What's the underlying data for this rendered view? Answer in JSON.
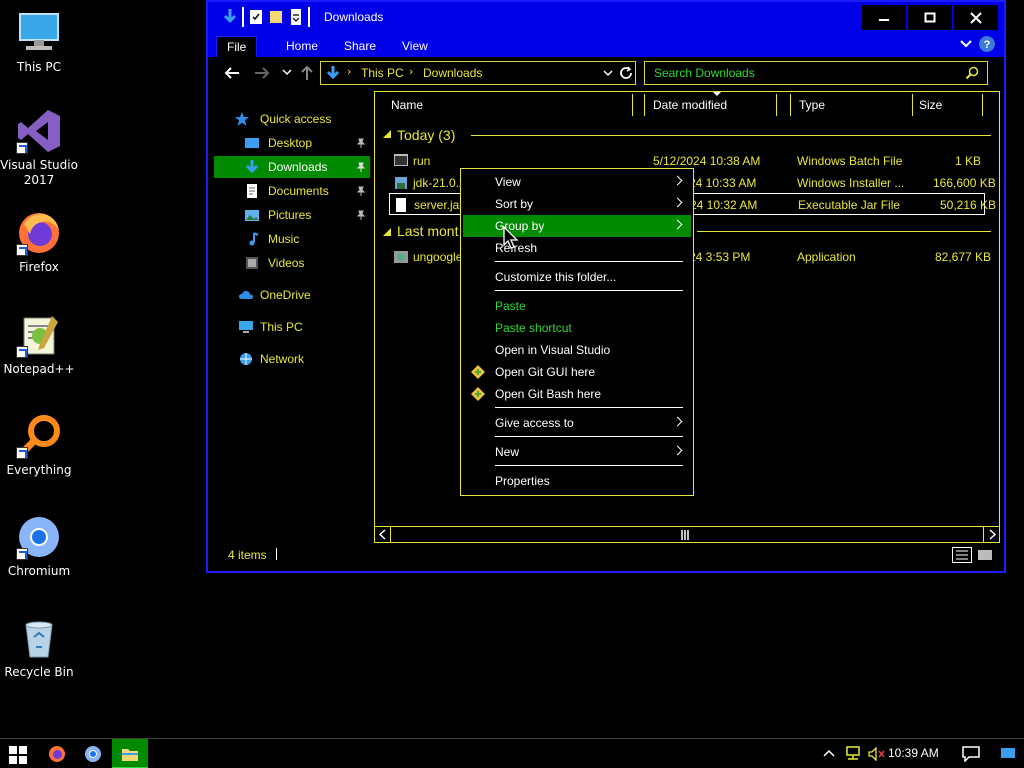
{
  "desktop": {
    "icons": [
      {
        "label": "This PC"
      },
      {
        "label": "Visual Studio 2017"
      },
      {
        "label": "Firefox"
      },
      {
        "label": "Notepad++"
      },
      {
        "label": "Everything"
      },
      {
        "label": "Chromium"
      },
      {
        "label": "Recycle Bin"
      }
    ]
  },
  "window": {
    "title": "Downloads",
    "ribbon_tabs": [
      "File",
      "Home",
      "Share",
      "View"
    ],
    "address": {
      "parts": [
        "This PC",
        "Downloads"
      ]
    },
    "search_placeholder": "Search Downloads",
    "nav": [
      {
        "label": "Quick access"
      },
      {
        "label": "Desktop"
      },
      {
        "label": "Downloads"
      },
      {
        "label": "Documents"
      },
      {
        "label": "Pictures"
      },
      {
        "label": "Music"
      },
      {
        "label": "Videos"
      },
      {
        "label": "OneDrive"
      },
      {
        "label": "This PC"
      },
      {
        "label": "Network"
      }
    ],
    "columns": [
      "Name",
      "Date modified",
      "Type",
      "Size"
    ],
    "groups": [
      {
        "label": "Today (3)"
      },
      {
        "label": "Last mont"
      }
    ],
    "files": [
      {
        "name": "run",
        "date": "5/12/2024 10:38 AM",
        "type": "Windows Batch File",
        "size": "1 KB"
      },
      {
        "name": "jdk-21.0.2",
        "date": "24 10:33 AM",
        "type": "Windows Installer ...",
        "size": "166,600 KB"
      },
      {
        "name": "server.jar",
        "date": "24 10:32 AM",
        "type": "Executable Jar File",
        "size": "50,216 KB"
      },
      {
        "name": "ungoogle",
        "date": "24 3:53 PM",
        "type": "Application",
        "size": "82,677 KB"
      }
    ],
    "status": "4 items"
  },
  "context_menu": {
    "items": [
      {
        "label": "View",
        "submenu": true
      },
      {
        "label": "Sort by",
        "submenu": true
      },
      {
        "label": "Group by",
        "submenu": true
      },
      {
        "label": "Refresh"
      },
      {
        "label": "Customize this folder..."
      },
      {
        "label": "Paste"
      },
      {
        "label": "Paste shortcut"
      },
      {
        "label": "Open in Visual Studio"
      },
      {
        "label": "Open Git GUI here"
      },
      {
        "label": "Open Git Bash here"
      },
      {
        "label": "Give access to",
        "submenu": true
      },
      {
        "label": "New",
        "submenu": true
      },
      {
        "label": "Properties"
      }
    ]
  },
  "taskbar": {
    "clock": "10:39 AM"
  },
  "colors": {
    "title_blue": "#0000e8",
    "accent_yellow": "#e7e73a",
    "highlight_green": "#008a00",
    "paste_green": "#31d831"
  }
}
